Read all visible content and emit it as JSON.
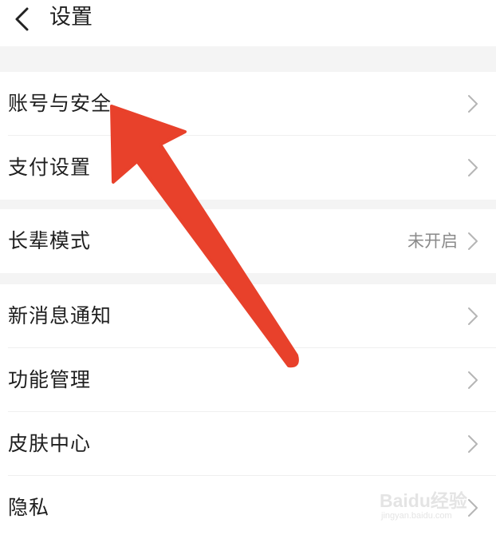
{
  "header": {
    "title": "设置",
    "back_icon": "chevron-left-icon"
  },
  "rows": [
    {
      "label": "账号与安全",
      "value": ""
    },
    {
      "label": "支付设置",
      "value": ""
    },
    {
      "label": "长辈模式",
      "value": "未开启"
    },
    {
      "label": "新消息通知",
      "value": ""
    },
    {
      "label": "功能管理",
      "value": ""
    },
    {
      "label": "皮肤中心",
      "value": ""
    },
    {
      "label": "隐私",
      "value": ""
    }
  ],
  "annotation": {
    "arrow_color": "#e8412b"
  },
  "watermark": {
    "logo_text": "Baidu经验",
    "url_text": "jingyan.baidu.com"
  },
  "colors": {
    "background": "#ffffff",
    "section_gap": "#f4f4f4",
    "text_primary": "#1f1f1f",
    "text_secondary": "#8a8a8a",
    "chevron": "#b5b5b5"
  }
}
